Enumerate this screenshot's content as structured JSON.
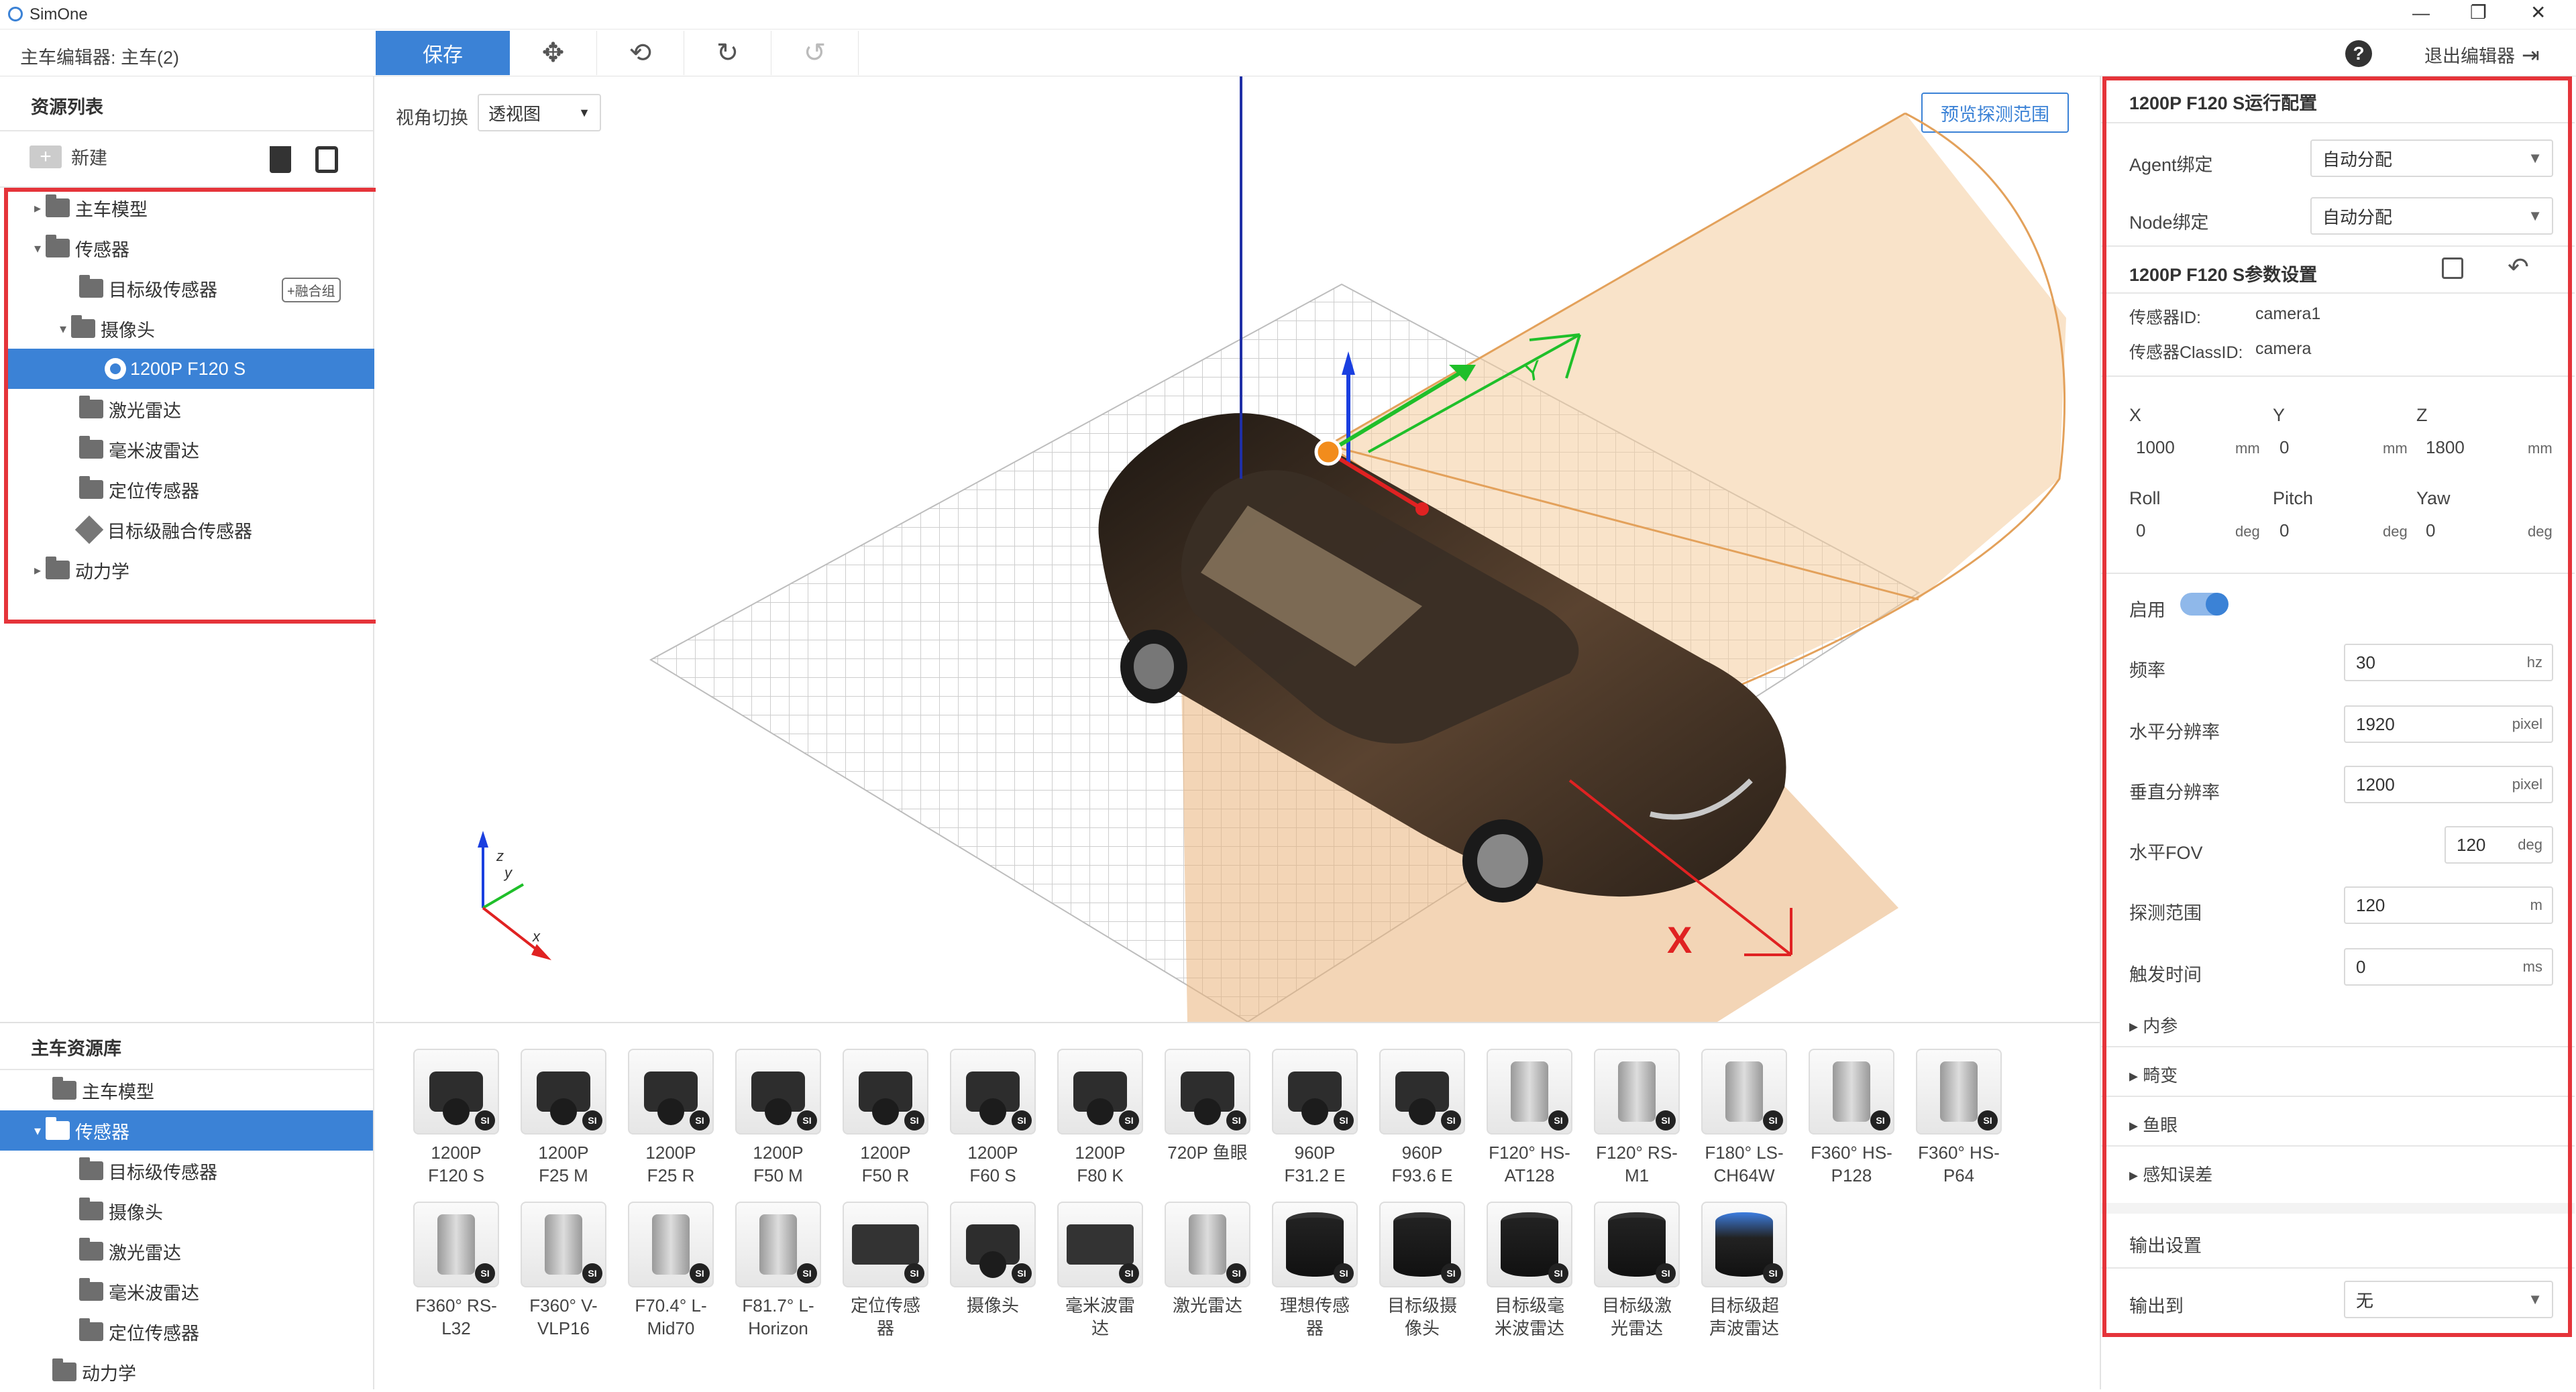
{
  "app": {
    "title": "SimOne",
    "window_controls": [
      "—",
      "❐",
      "✕"
    ]
  },
  "toolbar": {
    "breadcrumb": "主车编辑器: 主车(2)",
    "save": "保存",
    "help": "?",
    "exit": "退出编辑器"
  },
  "left": {
    "resources_title": "资源列表",
    "new_label": "新建",
    "tree": [
      {
        "label": "主车模型",
        "caret": "▸",
        "indent": 0,
        "icon": "folder-icon"
      },
      {
        "label": "传感器",
        "caret": "▾",
        "indent": 0,
        "icon": "folder-open-icon"
      },
      {
        "label": "目标级传感器",
        "caret": "",
        "indent": 1,
        "icon": "folder-icon",
        "badge": "+融合组"
      },
      {
        "label": "摄像头",
        "caret": "▾",
        "indent": 1,
        "icon": "folder-open-icon"
      },
      {
        "label": "1200P F120 S",
        "caret": "",
        "indent": 2,
        "icon": "camera-icon",
        "selected": true
      },
      {
        "label": "激光雷达",
        "caret": "",
        "indent": 1,
        "icon": "folder-icon"
      },
      {
        "label": "毫米波雷达",
        "caret": "",
        "indent": 1,
        "icon": "folder-icon"
      },
      {
        "label": "定位传感器",
        "caret": "",
        "indent": 1,
        "icon": "folder-icon"
      },
      {
        "label": "目标级融合传感器",
        "caret": "",
        "indent": 1,
        "icon": "fusion-icon"
      },
      {
        "label": "动力学",
        "caret": "▸",
        "indent": 0,
        "icon": "folder-icon"
      }
    ],
    "library_title": "主车资源库",
    "library_tree": [
      {
        "label": "主车模型",
        "caret": "",
        "indent": 0
      },
      {
        "label": "传感器",
        "caret": "▾",
        "indent": 0,
        "selected": true
      },
      {
        "label": "目标级传感器",
        "caret": "",
        "indent": 1
      },
      {
        "label": "摄像头",
        "caret": "",
        "indent": 1
      },
      {
        "label": "激光雷达",
        "caret": "",
        "indent": 1
      },
      {
        "label": "毫米波雷达",
        "caret": "",
        "indent": 1
      },
      {
        "label": "定位传感器",
        "caret": "",
        "indent": 1
      },
      {
        "label": "动力学",
        "caret": "",
        "indent": 0
      }
    ]
  },
  "viewport": {
    "view_label": "视角切换",
    "view_value": "透视图",
    "preview_button": "预览探测范围",
    "y_axis_label": "Y",
    "x_axis_label": "X",
    "mini_z": "z",
    "mini_y": "y",
    "mini_x": "x"
  },
  "right": {
    "title": "1200P F120 S运行配置",
    "agent_label": "Agent绑定",
    "agent_value": "自动分配",
    "node_label": "Node绑定",
    "node_value": "自动分配",
    "params_title": "1200P F120 S参数设置",
    "sensor_id_label": "传感器ID:",
    "sensor_id": "camera1",
    "class_id_label": "传感器ClassID:",
    "class_id": "camera",
    "x_label": "X",
    "x": "1000",
    "y_label": "Y",
    "y": "0",
    "z_label": "Z",
    "z": "1800",
    "mm": "mm",
    "roll_label": "Roll",
    "roll": "0",
    "pitch_label": "Pitch",
    "pitch": "0",
    "yaw_label": "Yaw",
    "yaw": "0",
    "deg": "deg",
    "enable_label": "启用",
    "enabled": true,
    "freq_label": "频率",
    "freq": "30",
    "freq_unit": "hz",
    "hres_label": "水平分辨率",
    "hres": "1920",
    "pixel": "pixel",
    "vres_label": "垂直分辨率",
    "vres": "1200",
    "hfov_label": "水平FOV",
    "hfov": "120",
    "hfov_unit": "deg",
    "range_label": "探测范围",
    "range": "120",
    "range_unit": "m",
    "trigger_label": "触发时间",
    "trigger": "0",
    "trigger_unit": "ms",
    "sections": [
      "内参",
      "畸变",
      "鱼眼",
      "感知误差"
    ],
    "output_title": "输出设置",
    "output_label": "输出到",
    "output_value": "无"
  },
  "library": {
    "items": [
      {
        "line1": "1200P",
        "line2": "F120 S",
        "kind": "cam"
      },
      {
        "line1": "1200P",
        "line2": "F25 M",
        "kind": "cam"
      },
      {
        "line1": "1200P",
        "line2": "F25 R",
        "kind": "cam"
      },
      {
        "line1": "1200P",
        "line2": "F50 M",
        "kind": "cam"
      },
      {
        "line1": "1200P",
        "line2": "F50 R",
        "kind": "cam"
      },
      {
        "line1": "1200P",
        "line2": "F60 S",
        "kind": "cam"
      },
      {
        "line1": "1200P",
        "line2": "F80 K",
        "kind": "cam"
      },
      {
        "line1": "720P 鱼眼",
        "line2": "",
        "kind": "cam"
      },
      {
        "line1": "960P",
        "line2": "F31.2 E",
        "kind": "cam"
      },
      {
        "line1": "960P",
        "line2": "F93.6 E",
        "kind": "cam"
      },
      {
        "line1": "F120° HS-",
        "line2": "AT128",
        "kind": "lid"
      },
      {
        "line1": "F120° RS-",
        "line2": "M1",
        "kind": "lid"
      },
      {
        "line1": "F180° LS-",
        "line2": "CH64W",
        "kind": "lid"
      },
      {
        "line1": "F360° HS-",
        "line2": "P128",
        "kind": "lid"
      },
      {
        "line1": "F360° HS-",
        "line2": "P64",
        "kind": "lid"
      },
      {
        "line1": "F360° RS-",
        "line2": "L32",
        "kind": "lid"
      },
      {
        "line1": "F360° V-",
        "line2": "VLP16",
        "kind": "lid"
      },
      {
        "line1": "F70.4° L-",
        "line2": "Mid70",
        "kind": "lid"
      },
      {
        "line1": "F81.7° L-",
        "line2": "Horizon",
        "kind": "lid"
      },
      {
        "line1": "定位传感",
        "line2": "器",
        "kind": "box"
      },
      {
        "line1": "摄像头",
        "line2": "",
        "kind": "cam"
      },
      {
        "line1": "毫米波雷",
        "line2": "达",
        "kind": "box"
      },
      {
        "line1": "激光雷达",
        "line2": "",
        "kind": "lid"
      },
      {
        "line1": "理想传感",
        "line2": "器",
        "kind": "cyl"
      },
      {
        "line1": "目标级摄",
        "line2": "像头",
        "kind": "cyl"
      },
      {
        "line1": "目标级毫",
        "line2": "米波雷达",
        "kind": "cyl"
      },
      {
        "line1": "目标级激",
        "line2": "光雷达",
        "kind": "cyl"
      },
      {
        "line1": "目标级超",
        "line2": "声波雷达",
        "kind": "blue"
      }
    ],
    "badge": "SI"
  }
}
